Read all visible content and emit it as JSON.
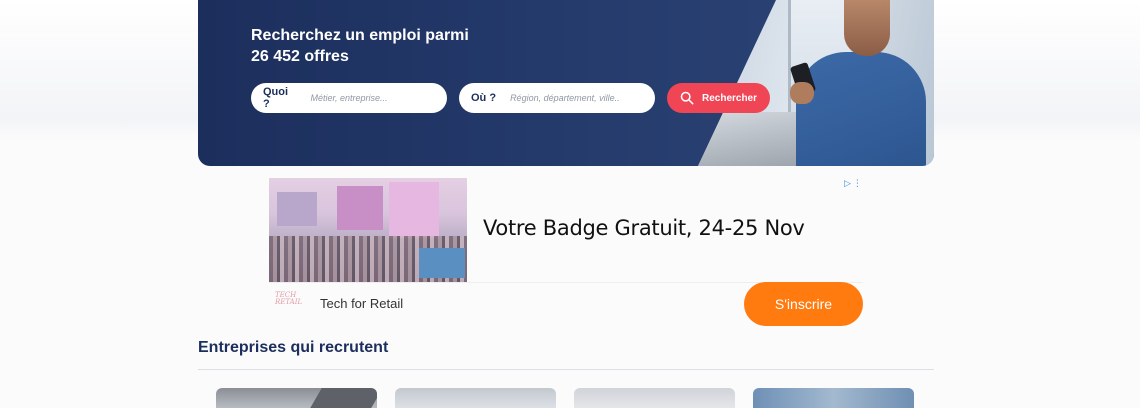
{
  "hero": {
    "title_line1": "Recherchez un emploi parmi",
    "title_line2": "26 452 offres",
    "what": {
      "label": "Quoi ?",
      "placeholder": "Métier, entreprise..."
    },
    "where": {
      "label": "Où ?",
      "placeholder": "Région, département, ville.."
    },
    "search_button": "Rechercher"
  },
  "ad": {
    "headline": "Votre Badge Gratuit, 24-25 Nov",
    "advertiser": "Tech for Retail",
    "logo_line1": "TECH",
    "logo_line2": "RETAIL",
    "cta": "S'inscrire"
  },
  "companies": {
    "title": "Entreprises qui recrutent"
  },
  "colors": {
    "navy": "#1c2e5c",
    "search_red": "#ef4554",
    "ad_orange": "#ff7a0f"
  }
}
